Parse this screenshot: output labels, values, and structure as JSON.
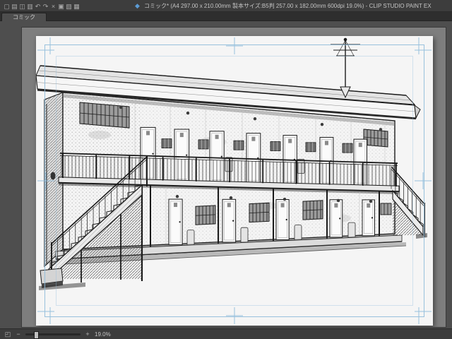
{
  "window": {
    "title": "コミック* (A4 297.00 x 210.00mm 製本サイズ:B5判 257.00 x 182.00mm 600dpi 19.0%) - CLIP STUDIO PAINT EX"
  },
  "toolbar": {
    "icons": [
      {
        "name": "new-file-icon",
        "glyph": "▢"
      },
      {
        "name": "open-file-icon",
        "glyph": "▤"
      },
      {
        "name": "save-icon",
        "glyph": "◫"
      },
      {
        "name": "print-icon",
        "glyph": "▥"
      },
      {
        "name": "undo-icon",
        "glyph": "↶"
      },
      {
        "name": "redo-icon",
        "glyph": "↷"
      },
      {
        "name": "delete-icon",
        "glyph": "×"
      },
      {
        "name": "copy-icon",
        "glyph": "▣"
      },
      {
        "name": "paste-icon",
        "glyph": "▧"
      },
      {
        "name": "grid-icon",
        "glyph": "▦"
      }
    ],
    "mode_icon": {
      "name": "workspace-mode-icon",
      "glyph": "◆",
      "color": "#5b9bd5"
    }
  },
  "tabbar": {
    "tabs": [
      {
        "label": "コミック",
        "active": true
      }
    ]
  },
  "canvas": {
    "guide_color": "#8fbcdb"
  },
  "statusbar": {
    "fit_glyph": "◰",
    "zoom_out_glyph": "−",
    "zoom_in_glyph": "+",
    "zoom_value": "19.0%",
    "zoom_fraction": 0.15
  }
}
